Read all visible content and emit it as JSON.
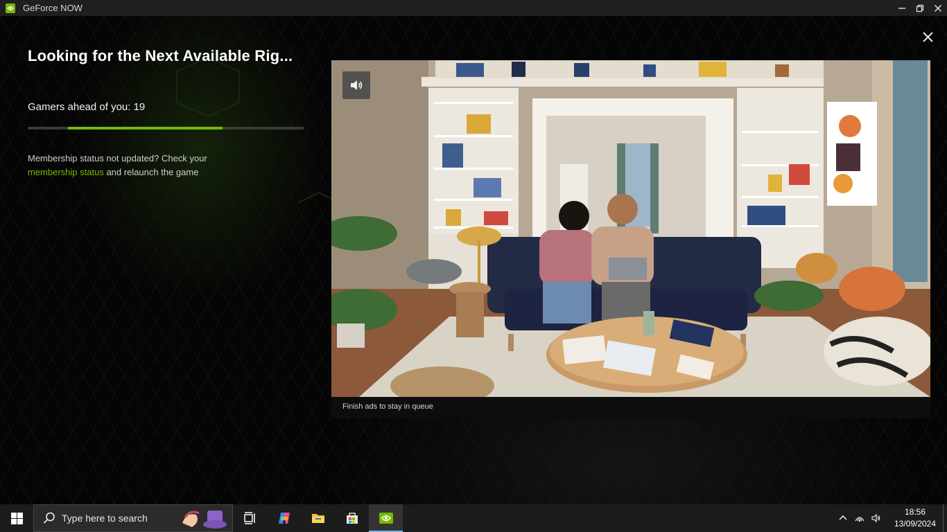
{
  "window": {
    "title": "GeForce NOW",
    "controls": [
      "minimize-icon",
      "restore-icon",
      "close-icon"
    ]
  },
  "queue": {
    "title": "Looking for the Next Available Rig...",
    "gamers_ahead_label": "Gamers ahead of you: 19",
    "progress_percent": 56,
    "membership_text_1": "Membership status not updated? Check your",
    "membership_link": "membership status",
    "membership_text_2": " and relaunch the game"
  },
  "ad": {
    "caption": "Finish ads to stay in queue",
    "mute_icon": "speaker-icon"
  },
  "taskbar": {
    "search_placeholder": "Type here to search",
    "apps": [
      "task-view-icon",
      "copilot-icon",
      "file-explorer-icon",
      "microsoft-store-icon",
      "geforce-now-icon"
    ],
    "active_app": "geforce-now-icon",
    "tray_icons": [
      "chevron-up-icon",
      "network-icon",
      "volume-icon"
    ],
    "time": "18:56",
    "date": "13/09/2024"
  },
  "colors": {
    "accent": "#76b900",
    "background": "#050505",
    "titlebar": "#1f1f1f",
    "taskbar": "#1c1c1c"
  }
}
